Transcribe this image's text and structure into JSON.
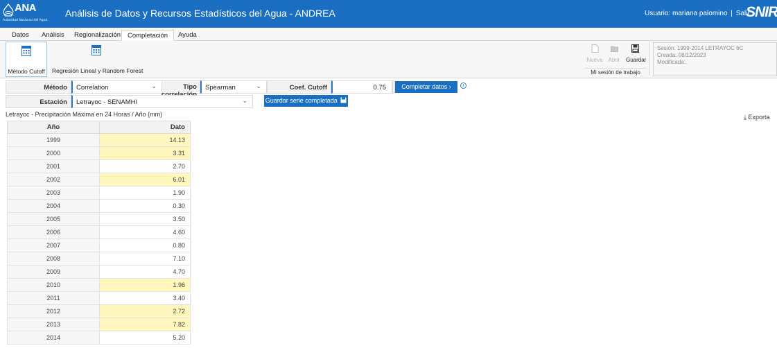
{
  "header": {
    "logo_text": "ANA",
    "logo_subtext": "Autoridad Nacional del Agua",
    "title": "Análisis de Datos y Recursos Estadísticos del Agua - ANDREA",
    "user_label": "Usuario: mariana palomino",
    "separator": "|",
    "logout_label": "Salir",
    "partner_logo": "SNIRH",
    "colors": {
      "bar": "#1a6fc2"
    }
  },
  "tabs": [
    {
      "label": "Datos"
    },
    {
      "label": "Análisis"
    },
    {
      "label": "Regionalización"
    },
    {
      "label": "Completación",
      "active": true
    },
    {
      "label": "Ayuda"
    }
  ],
  "ribbon": {
    "methods": [
      {
        "label": "Método Cutoff",
        "icon": "calculator-icon",
        "active": true
      },
      {
        "label": "Regresión Lineal y Random Forest",
        "icon": "calculator-icon",
        "active": false
      }
    ],
    "session_buttons": [
      {
        "label": "Nueva",
        "icon": "new-file-icon",
        "enabled": false
      },
      {
        "label": "Abrir",
        "icon": "folder-icon",
        "enabled": false
      },
      {
        "label": "Guardar",
        "icon": "save-icon",
        "enabled": true
      }
    ],
    "session_caption": "Mi sesión de trabajo",
    "session_info": {
      "session": "Sesión: 1999-2014 LETRAYOC 6C",
      "created": "Creada: 08/12/2023",
      "modified": "Modificada:"
    }
  },
  "form": {
    "method_label": "Método",
    "method_value": "Correlation",
    "corr_type_label": "Tipo correlación",
    "corr_type_value": "Spearman",
    "cutoff_label": "Coef. Cutoff",
    "cutoff_value": "0.75",
    "complete_button": "Completar datos",
    "station_label": "Estación",
    "station_value": "Letrayoc - SENAMHI",
    "save_series_button": "Guardar serie completada"
  },
  "table": {
    "title": "Letrayoc - Precipitación Máxima en 24 Horas / Año (mm)",
    "export_label": "Exporta",
    "columns": [
      "Año",
      "Dato"
    ],
    "rows": [
      {
        "year": "1999",
        "value": "14.13",
        "filled": true
      },
      {
        "year": "2000",
        "value": "3.31",
        "filled": true
      },
      {
        "year": "2001",
        "value": "2.70",
        "filled": false
      },
      {
        "year": "2002",
        "value": "6.01",
        "filled": true
      },
      {
        "year": "2003",
        "value": "1.90",
        "filled": false
      },
      {
        "year": "2004",
        "value": "0.30",
        "filled": false
      },
      {
        "year": "2005",
        "value": "3.50",
        "filled": false
      },
      {
        "year": "2006",
        "value": "4.60",
        "filled": false
      },
      {
        "year": "2007",
        "value": "0.80",
        "filled": false
      },
      {
        "year": "2008",
        "value": "7.10",
        "filled": false
      },
      {
        "year": "2009",
        "value": "4.70",
        "filled": false
      },
      {
        "year": "2010",
        "value": "1.96",
        "filled": true
      },
      {
        "year": "2011",
        "value": "3.40",
        "filled": false
      },
      {
        "year": "2012",
        "value": "2.72",
        "filled": true
      },
      {
        "year": "2013",
        "value": "7.82",
        "filled": true
      },
      {
        "year": "2014",
        "value": "5.20",
        "filled": false
      }
    ],
    "colors": {
      "filled": "#fff7bd"
    }
  }
}
